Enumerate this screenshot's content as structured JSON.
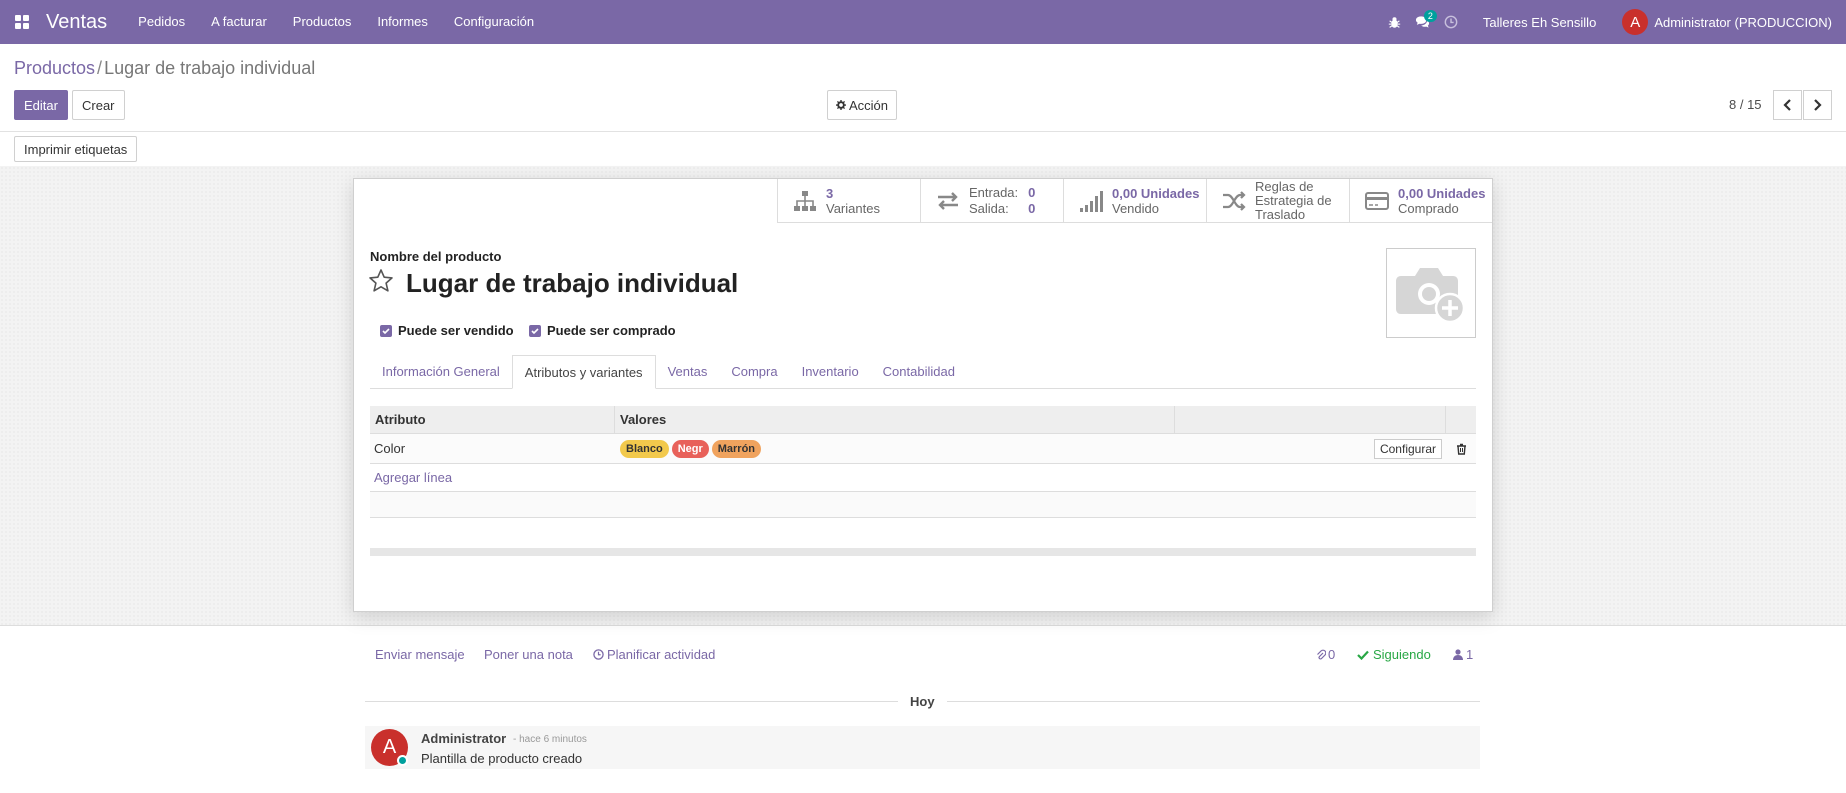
{
  "navbar": {
    "brand": "Ventas",
    "menu": [
      "Pedidos",
      "A facturar",
      "Productos",
      "Informes",
      "Configuración"
    ],
    "messages_count": "2",
    "company": "Talleres Eh Sensillo",
    "user_initial": "A",
    "user_name": "Administrator (PRODUCCION)"
  },
  "breadcrumb": {
    "parent": "Productos",
    "separator": "/",
    "current": "Lugar de trabajo individual"
  },
  "toolbar": {
    "edit_label": "Editar",
    "create_label": "Crear",
    "action_label": "Acción",
    "print_labels": "Imprimir etiquetas"
  },
  "pager": {
    "value": "8 / 15"
  },
  "smart_buttons": {
    "variants_value": "3",
    "variants_label": "Variantes",
    "in_label": "Entrada:",
    "in_value": "0",
    "out_label": "Salida:",
    "out_value": "0",
    "sold_value": "0,00 Unidades",
    "sold_label": "Vendido",
    "routes_label": "Reglas de Estrategia de Traslado",
    "purchased_value": "0,00 Unidades",
    "purchased_label": "Comprado"
  },
  "product": {
    "name_label": "Nombre del producto",
    "name": "Lugar de trabajo individual",
    "can_be_sold": "Puede ser vendido",
    "can_be_purchased": "Puede ser comprado"
  },
  "tabs": [
    {
      "label": "Información General",
      "active": false
    },
    {
      "label": "Atributos y variantes",
      "active": true
    },
    {
      "label": "Ventas",
      "active": false
    },
    {
      "label": "Compra",
      "active": false
    },
    {
      "label": "Inventario",
      "active": false
    },
    {
      "label": "Contabilidad",
      "active": false
    }
  ],
  "attributes_table": {
    "headers": [
      "Atributo",
      "Valores"
    ],
    "rows": [
      {
        "attribute": "Color",
        "values": [
          {
            "label": "Blanco",
            "color": "#f2c94c"
          },
          {
            "label": "Negr",
            "color": "#e8615a"
          },
          {
            "label": "Marrón",
            "color": "#f0a35e"
          }
        ],
        "configure_label": "Configurar"
      }
    ],
    "add_line": "Agregar línea"
  },
  "chatter": {
    "send_message": "Enviar mensaje",
    "log_note": "Poner una nota",
    "schedule_activity": "Planificar actividad",
    "attachments_count": "0",
    "following": "Siguiendo",
    "followers_count": "1",
    "day_label": "Hoy",
    "message": {
      "author_initial": "A",
      "author": "Administrator",
      "date": "- hace 6 minutos",
      "body": "Plantilla de producto creado"
    }
  },
  "colors": {
    "brand": "#7a68a6",
    "success": "#28a745",
    "avatar": "#c9302c",
    "online": "#00a09d"
  }
}
